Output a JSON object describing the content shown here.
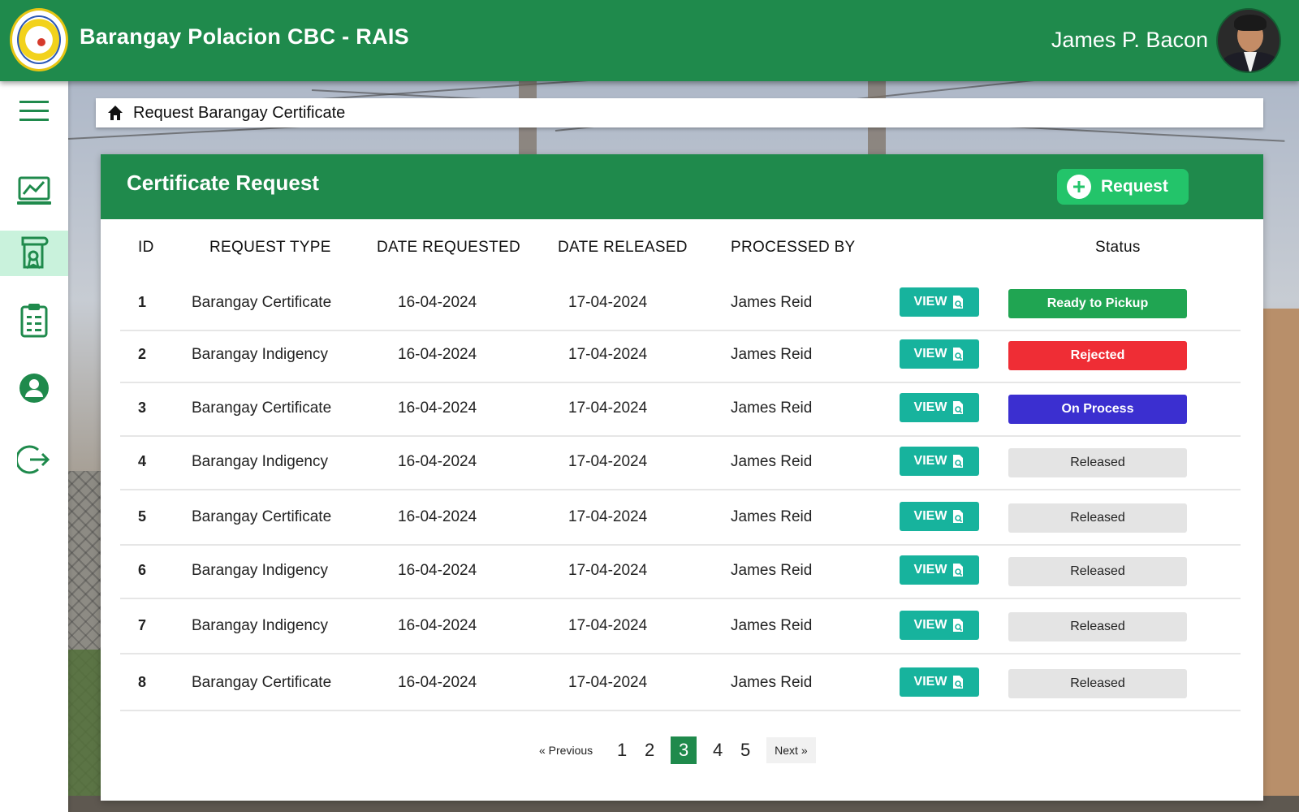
{
  "header": {
    "app_title": "Barangay Polacion CBC - RAIS",
    "user_name": "James P. Bacon",
    "brand_color": "#1f8a4c"
  },
  "sidebar": {
    "items": [
      {
        "icon": "menu-icon"
      },
      {
        "icon": "dashboard-chart-icon"
      },
      {
        "icon": "certificate-icon",
        "active": true
      },
      {
        "icon": "clipboard-icon"
      },
      {
        "icon": "profile-icon"
      },
      {
        "icon": "logout-icon"
      }
    ]
  },
  "breadcrumb": {
    "icon": "home-icon",
    "text": "Request Barangay Certificate"
  },
  "card": {
    "title": "Certificate Request",
    "request_button": "Request"
  },
  "table": {
    "headers": {
      "id": "ID",
      "request_type": "REQUEST TYPE",
      "date_requested": "DATE REQUESTED",
      "date_released": "DATE RELEASED",
      "processed_by": "PROCESSED BY",
      "status": "Status"
    },
    "view_label": "VIEW",
    "rows": [
      {
        "id": "1",
        "type": "Barangay Certificate",
        "requested": "16-04-2024",
        "released": "17-04-2024",
        "processed_by": "James Reid",
        "status": "Ready to Pickup",
        "status_color": "#20a552"
      },
      {
        "id": "2",
        "type": "Barangay Indigency",
        "requested": "16-04-2024",
        "released": "17-04-2024",
        "processed_by": "James Reid",
        "status": "Rejected",
        "status_color": "#ef2d35"
      },
      {
        "id": "3",
        "type": "Barangay Certificate",
        "requested": "16-04-2024",
        "released": "17-04-2024",
        "processed_by": "James Reid",
        "status": "On Process",
        "status_color": "#3b2fd0"
      },
      {
        "id": "4",
        "type": "Barangay Indigency",
        "requested": "16-04-2024",
        "released": "17-04-2024",
        "processed_by": "James Reid",
        "status": "Released",
        "status_color": "#e4e4e4"
      },
      {
        "id": "5",
        "type": "Barangay Certificate",
        "requested": "16-04-2024",
        "released": "17-04-2024",
        "processed_by": "James Reid",
        "status": "Released",
        "status_color": "#e4e4e4"
      },
      {
        "id": "6",
        "type": "Barangay Indigency",
        "requested": "16-04-2024",
        "released": "17-04-2024",
        "processed_by": "James Reid",
        "status": "Released",
        "status_color": "#e4e4e4"
      },
      {
        "id": "7",
        "type": "Barangay Indigency",
        "requested": "16-04-2024",
        "released": "17-04-2024",
        "processed_by": "James Reid",
        "status": "Released",
        "status_color": "#e4e4e4"
      },
      {
        "id": "8",
        "type": "Barangay Certificate",
        "requested": "16-04-2024",
        "released": "17-04-2024",
        "processed_by": "James Reid",
        "status": "Released",
        "status_color": "#e4e4e4"
      }
    ]
  },
  "pagination": {
    "previous": "« Previous",
    "pages": [
      "1",
      "2",
      "3",
      "4",
      "5"
    ],
    "current": "3",
    "next": "Next »"
  }
}
